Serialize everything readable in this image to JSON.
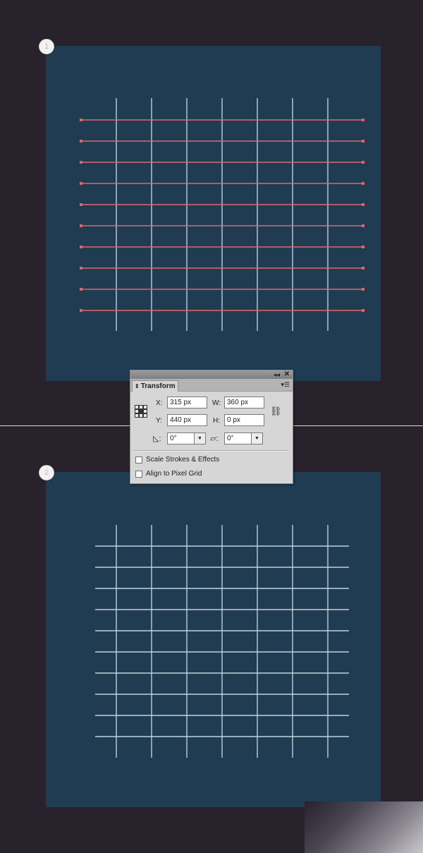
{
  "steps": [
    "1",
    "2"
  ],
  "grid": {
    "vertical_line_count": 7,
    "horizontal_line_count": 10,
    "vertical_line_color": "#a9bdcc",
    "selected_line_color": "#e0666a",
    "unselected_line_color": "#c4d2dc"
  },
  "colors": {
    "background": "#27222c",
    "artboard": "#1f3c52",
    "panel": "#d6d6d6"
  },
  "transform_panel": {
    "title": "Transform",
    "x_label": "X:",
    "x_value": "315 px",
    "w_label": "W:",
    "w_value": "360 px",
    "y_label": "Y:",
    "y_value": "440 px",
    "h_label": "H:",
    "h_value": "0 px",
    "rotate_value": "0°",
    "shear_value": "0°",
    "scale_strokes_label": "Scale Strokes & Effects",
    "scale_strokes_checked": false,
    "align_pixel_grid_label": "Align to Pixel Grid",
    "align_pixel_grid_checked": false,
    "icons": {
      "collapse": "double-chevron-left-icon",
      "close": "close-icon",
      "menu": "panel-menu-icon",
      "reference_point": "reference-point-icon",
      "constrain": "constrain-proportions-icon",
      "rotate": "rotate-angle-icon",
      "shear": "shear-icon"
    }
  }
}
